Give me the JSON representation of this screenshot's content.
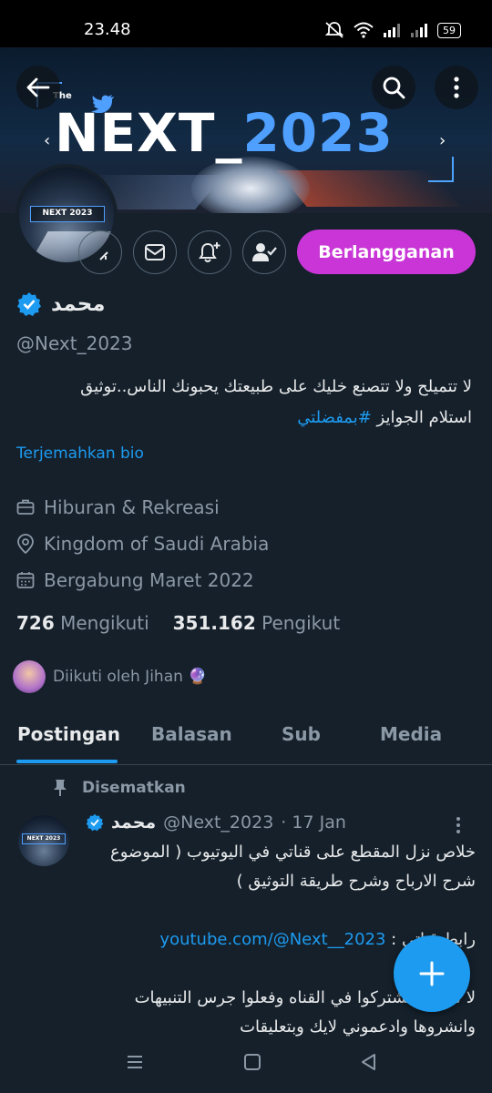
{
  "status_bar": {
    "time": "23.48",
    "battery": "59"
  },
  "banner": {
    "logo_prefix": "The",
    "logo_main": "NEXT_",
    "logo_year": "2023"
  },
  "avatar": {
    "tag": "NEXT 2023"
  },
  "actions": {
    "subscribe_label": "Berlangganan"
  },
  "profile": {
    "name": "محمد",
    "handle": "@Next_2023",
    "bio_line1": "لا تتميلح ولا تتصنع خليك على طبيعتك يحبونك الناس..توثيق",
    "bio_line2_text": "استلام الجوايز ",
    "bio_hashtag": "#بمفضلتي",
    "translate_label": "Terjemahkan bio",
    "category": "Hiburan & Rekreasi",
    "location": "Kingdom of Saudi Arabia",
    "joined": "Bergabung Maret 2022",
    "following_count": "726",
    "following_label": "Mengikuti",
    "followers_count": "351.162",
    "followers_label": "Pengikut",
    "followed_by": "Diikuti oleh Jihan 🔮"
  },
  "tabs": [
    {
      "label": "Postingan"
    },
    {
      "label": "Balasan"
    },
    {
      "label": "Sub"
    },
    {
      "label": "Media"
    }
  ],
  "pinned_tweet": {
    "pinned_label": "Disematkan",
    "author_name": "محمد",
    "author_handle": "@Next_2023",
    "date": "· 17 Jan",
    "avatar_tag": "NEXT 2023",
    "line1": "خلاص نزل المقطع على قناتي في اليوتيوب ( الموضوع",
    "line2": "شرح الارباح وشرح طريقة التوثيق )",
    "link_prefix": "رابط قناتي : ",
    "link": "youtube.com/@Next__2023",
    "line4": "لا تنسون تشتركوا في القناه وفعلوا جرس التنبيهات",
    "line5": "وانشروها وادعموني لايك وبتعليقات"
  },
  "colors": {
    "accent": "#1d9bf0",
    "subscribe": "#c935d6",
    "background": "#15202b"
  }
}
